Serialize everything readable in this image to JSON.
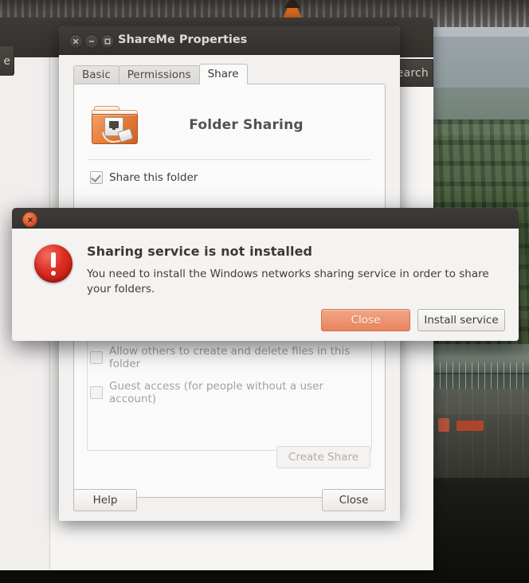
{
  "desktop": {
    "wallpaper_description": "aerial landscape photo with water, green vegetation bands and an industrial yard",
    "accent_color": "#e8855f",
    "error_color": "#de2d22"
  },
  "background_window": {
    "name": "file-manager",
    "search_button_label": "earch",
    "left_button_label": "e",
    "titlebar_buttons": [
      "close",
      "minimize"
    ]
  },
  "properties_window": {
    "title": "ShareMe Properties",
    "titlebar_buttons": [
      {
        "name": "close",
        "glyph": "close-icon"
      },
      {
        "name": "minimize",
        "glyph": "minimize-icon"
      },
      {
        "name": "maximize",
        "glyph": "maximize-icon"
      }
    ],
    "tabs": [
      {
        "label": "Basic",
        "active": false
      },
      {
        "label": "Permissions",
        "active": false
      },
      {
        "label": "Share",
        "active": true
      }
    ],
    "share_tab": {
      "heading": "Folder Sharing",
      "folder_icon": "shared-folder-icon",
      "share_this_folder": {
        "label": "Share this folder",
        "checked": true
      },
      "options": [
        {
          "label": "Allow others to create and delete files in this folder",
          "checked": false,
          "disabled": true
        },
        {
          "label": "Guest access (for people without a user account)",
          "checked": false,
          "disabled": true
        }
      ],
      "create_share_button": "Create Share"
    },
    "footer": {
      "help_label": "Help",
      "close_label": "Close"
    }
  },
  "alert_dialog": {
    "close_button_glyph": "close-icon",
    "icon": "error-icon",
    "heading": "Sharing service is not installed",
    "message": "You need to install the Windows networks sharing service in order to share your folders.",
    "buttons": {
      "primary": "Close",
      "secondary": "Install service"
    }
  }
}
